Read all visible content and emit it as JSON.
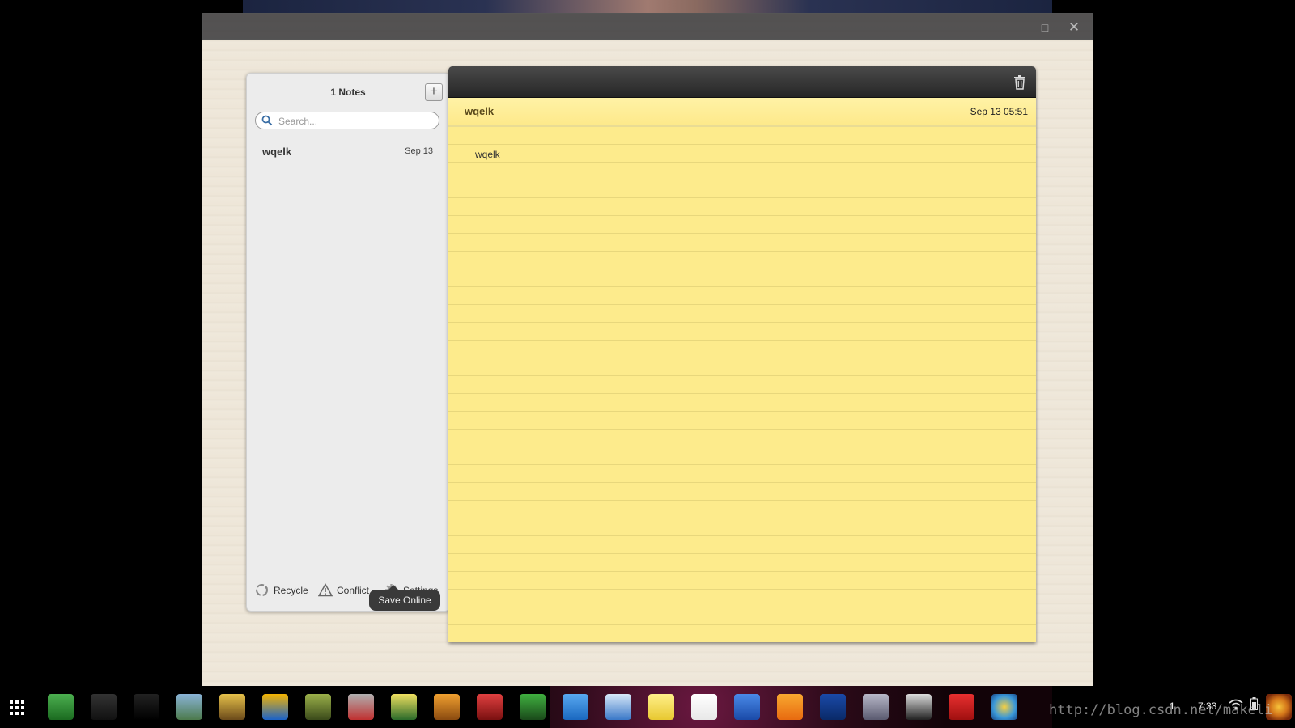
{
  "window": {
    "maximize_icon": "maximize-icon",
    "close_icon": "close-icon"
  },
  "sidebar": {
    "title": "1 Notes",
    "add_icon": "plus-icon",
    "search": {
      "placeholder": "Search...",
      "value": ""
    },
    "notes": [
      {
        "title": "wqelk",
        "date": "Sep 13"
      }
    ],
    "footer": {
      "recycle": "Recycle",
      "conflict": "Conflict",
      "settings": "Settings"
    }
  },
  "tooltip": {
    "text": "Save Online"
  },
  "editor": {
    "title": "wqelk",
    "date": "Sep 13 05:51",
    "body": "wqelk",
    "trash_icon": "trash-icon"
  },
  "taskbar": {
    "apps": [
      "launcher-icon",
      "video-player-icon",
      "amazon-icon",
      "photo-icon",
      "comic-icon",
      "blocks-icon",
      "robot-icon",
      "car-icon",
      "game-icon",
      "puzzle-icon",
      "angry-birds-icon",
      "maze-icon",
      "files-icon",
      "webstore-icon",
      "notes-icon",
      "gmail-icon",
      "docs-icon",
      "share-icon",
      "pencil-icon",
      "cube-icon",
      "darts-icon",
      "scrobble-icon",
      "earth-icon"
    ],
    "tray": {
      "badge": "1",
      "time": "7:33"
    }
  },
  "watermark": "http://blog.csdn.net/makeli",
  "colors": {
    "note_yellow": "#fdeb8c",
    "editor_bar": "#2e2e2e",
    "sidebar_bg": "#ececec"
  }
}
